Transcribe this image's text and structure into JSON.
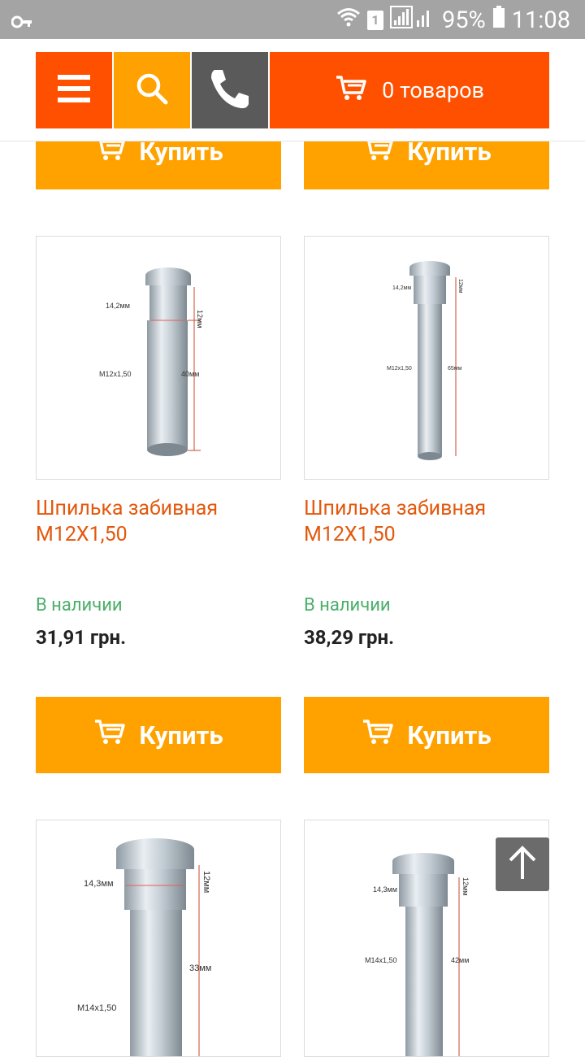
{
  "status_bar": {
    "battery": "95%",
    "time": "11:08",
    "sim": "1"
  },
  "header": {
    "cart_label": "0 товаров"
  },
  "buy_label": "Купить",
  "products": [
    {
      "title": "Шпилька забивная М12Х1,50",
      "stock": "В наличии",
      "price": "31,91 грн.",
      "img": {
        "dia": "14,2мм",
        "h1": "12мм",
        "thread": "M12x1,50",
        "len": "40мм"
      }
    },
    {
      "title": "Шпилька забивная М12Х1,50",
      "stock": "В наличии",
      "price": "38,29 грн.",
      "img": {
        "dia": "14,2мм",
        "h1": "12мм",
        "thread": "M12x1,50",
        "len": "65мм"
      }
    },
    {
      "img": {
        "dia": "14,3мм",
        "h1": "12мм",
        "thread": "M14x1,50",
        "len": "33мм"
      }
    },
    {
      "img": {
        "dia": "14,3мм",
        "h1": "12мм",
        "thread": "M14x1,50",
        "len": "42мм"
      }
    }
  ],
  "colors": {
    "orange": "#ff5000",
    "amber": "#ffa200",
    "gray": "#5a5a5a",
    "in_stock": "#4caf6a"
  }
}
